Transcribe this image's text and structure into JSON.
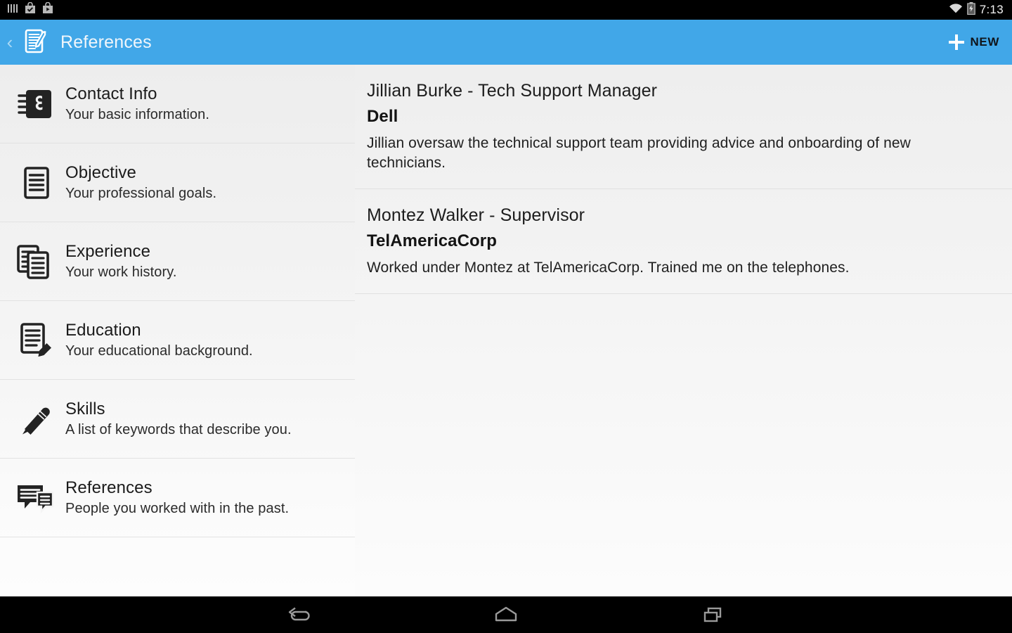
{
  "statusbar": {
    "time": "7:13",
    "left_icons": [
      "signal-bars-icon",
      "play-store-install-icon",
      "play-store-icon"
    ],
    "right_icons": [
      "wifi-icon",
      "battery-charging-icon"
    ]
  },
  "actionbar": {
    "back_glyph": "‹",
    "app_icon": "notepad-pen-icon",
    "title": "References",
    "new_label": "NEW",
    "bg_color": "#41a7e8",
    "title_color": "#f0f6fb"
  },
  "sidebar": {
    "items": [
      {
        "icon": "address-book-icon",
        "title": "Contact Info",
        "subtitle": "Your basic information."
      },
      {
        "icon": "document-lines-icon",
        "title": "Objective",
        "subtitle": "Your professional goals."
      },
      {
        "icon": "stacked-documents-icon",
        "title": "Experience",
        "subtitle": "Your work history."
      },
      {
        "icon": "document-pencil-icon",
        "title": "Education",
        "subtitle": "Your educational background."
      },
      {
        "icon": "pencil-icon",
        "title": "Skills",
        "subtitle": "A list of keywords that describe you."
      },
      {
        "icon": "speech-bubbles-icon",
        "title": "References",
        "subtitle": "People you worked with in the past."
      }
    ]
  },
  "detail": {
    "entries": [
      {
        "name": "Jillian Burke - Tech Support Manager",
        "company": "Dell",
        "description": "Jillian oversaw the technical support team providing advice and onboarding of new technicians."
      },
      {
        "name": "Montez Walker - Supervisor",
        "company": "TelAmericaCorp",
        "description": "Worked under Montez at TelAmericaCorp. Trained me on the telephones."
      }
    ]
  },
  "navbar": {
    "buttons": [
      "back-nav-icon",
      "home-nav-icon",
      "recents-nav-icon"
    ]
  }
}
